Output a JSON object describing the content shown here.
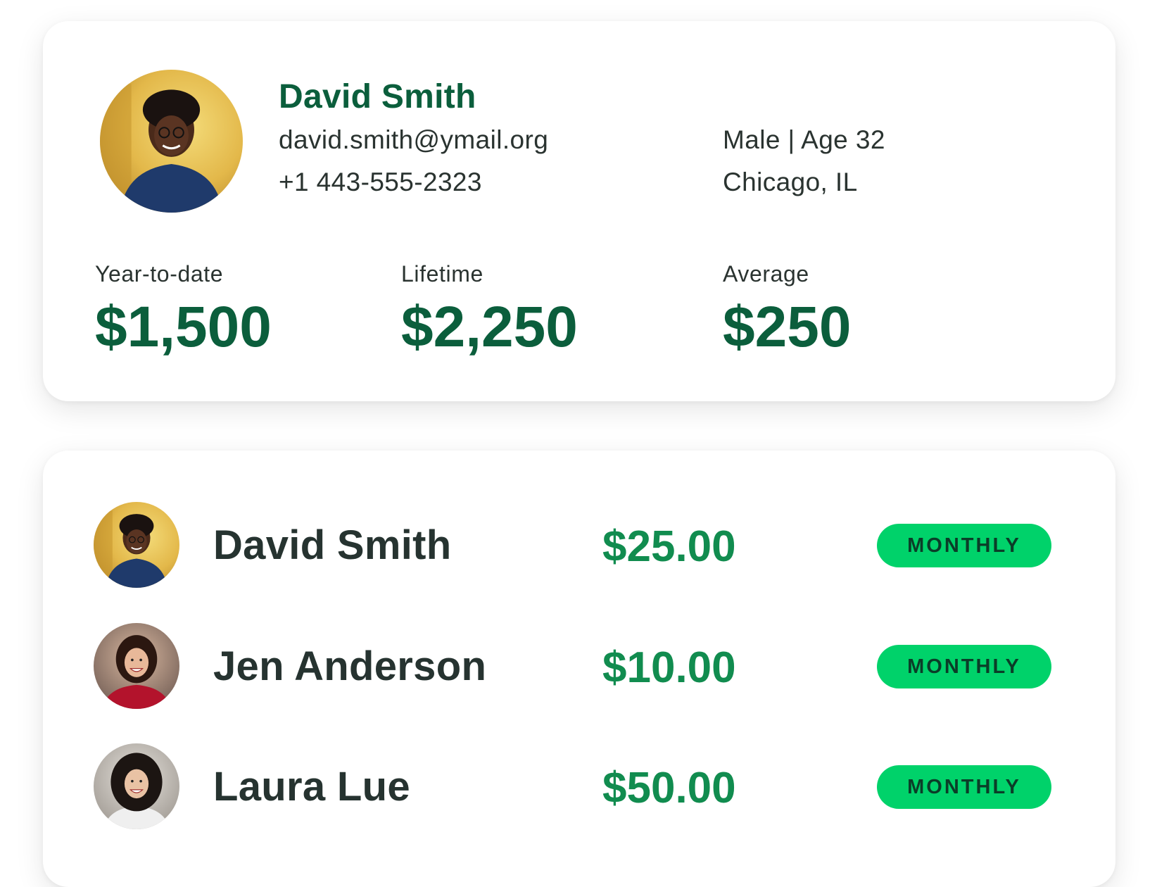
{
  "profile": {
    "name": "David Smith",
    "email": "david.smith@ymail.org",
    "phone": "+1 443-555-2323",
    "gender_age": "Male | Age 32",
    "location": "Chicago, IL",
    "avatar": "photo-man-glasses-yellow-bg"
  },
  "stats": [
    {
      "label": "Year-to-date",
      "value": "$1,500"
    },
    {
      "label": "Lifetime",
      "value": "$2,250"
    },
    {
      "label": "Average",
      "value": "$250"
    }
  ],
  "donors": [
    {
      "name": "David Smith",
      "amount": "$25.00",
      "frequency": "MONTHLY",
      "avatar": "photo-man-glasses-yellow-bg"
    },
    {
      "name": "Jen Anderson",
      "amount": "$10.00",
      "frequency": "MONTHLY",
      "avatar": "photo-woman-red-top"
    },
    {
      "name": "Laura Lue",
      "amount": "$50.00",
      "frequency": "MONTHLY",
      "avatar": "photo-woman-curly-hair"
    }
  ],
  "colors": {
    "name_green": "#0b5e3c",
    "amount_green": "#118c4f",
    "badge_green": "#00d26a",
    "text_dark": "#2a3330"
  }
}
